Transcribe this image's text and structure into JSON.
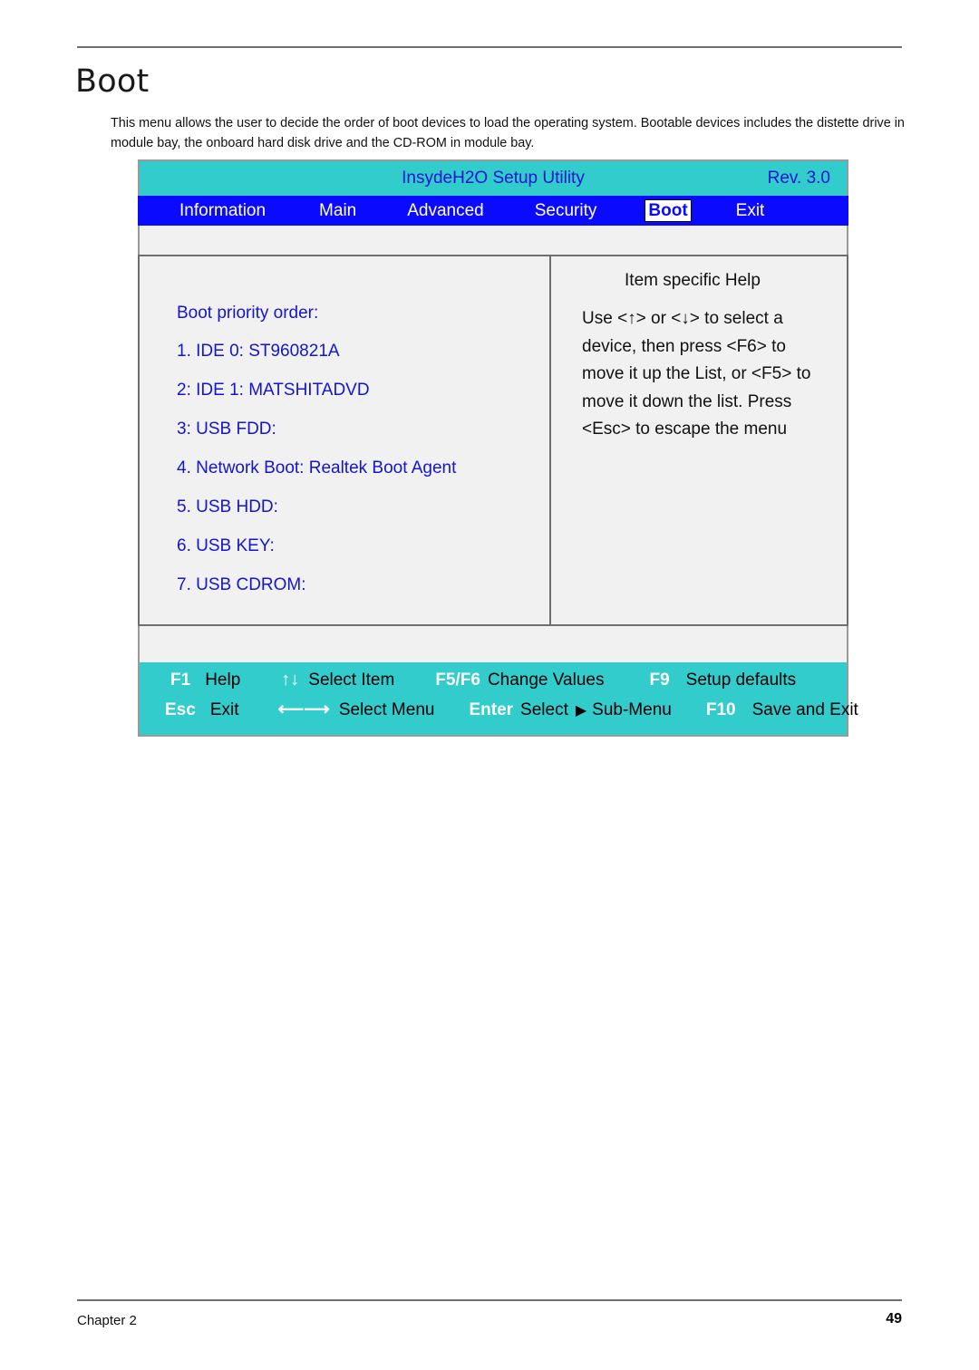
{
  "document": {
    "heading": "Boot",
    "intro": "This menu allows the user to decide the order of boot devices to load the operating system. Bootable devices includes the distette drive in module bay, the onboard hard disk drive and the CD-ROM in module bay.",
    "footer": {
      "chapter": "Chapter 2",
      "page_number": "49"
    }
  },
  "bios": {
    "title": "InsydeH2O Setup Utility",
    "revision": "Rev. 3.0",
    "menu": [
      {
        "label": "Information",
        "active": false
      },
      {
        "label": "Main",
        "active": false
      },
      {
        "label": "Advanced",
        "active": false
      },
      {
        "label": "Security",
        "active": false
      },
      {
        "label": "Boot",
        "active": true
      },
      {
        "label": "Exit",
        "active": false
      }
    ],
    "boot_panel": {
      "heading": "Boot priority order:",
      "items": [
        "1. IDE 0: ST960821A",
        "2: IDE 1: MATSHITADVD",
        "3: USB FDD:",
        "4. Network Boot: Realtek Boot Agent",
        "5. USB HDD:",
        "6. USB KEY:",
        "7. USB CDROM:"
      ]
    },
    "help_panel": {
      "title": "Item specific Help",
      "lines": [
        "Use <↑> or <↓> to select a",
        "device, then press <F6> to",
        "move it up the List, or <F5> to",
        "move it down the list. Press",
        "<Esc> to escape the menu"
      ]
    },
    "keybar": {
      "row1": {
        "k1": "F1",
        "l1": "Help",
        "arrow": "↑↓",
        "l2": "Select Item",
        "k2": "F5/F6",
        "l3": "Change Values",
        "k3": "F9",
        "l4": "Setup defaults"
      },
      "row2": {
        "k1": "Esc",
        "l1": "Exit",
        "arrow": "⟵⟶",
        "l2": "Select Menu",
        "k2": "Enter",
        "l3": "Select",
        "triangle": "▶",
        "l4": "Sub-Menu",
        "k3": "F10",
        "l5": "Save and Exit"
      }
    },
    "colors": {
      "title_bar": "#33CCCC",
      "menu_bar": "#0A0AFF",
      "accent_text": "#1414D2",
      "panel_bg": "#F1F1F1"
    }
  }
}
